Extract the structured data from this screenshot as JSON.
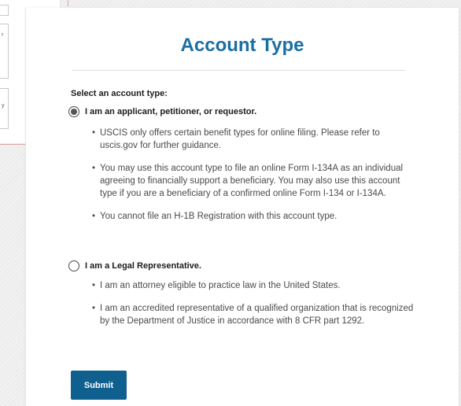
{
  "background": {
    "fragments": [
      "r",
      "y"
    ]
  },
  "page": {
    "title": "Account Type",
    "select_label": "Select an account type:"
  },
  "options": [
    {
      "label": "I am an applicant, petitioner, or requestor.",
      "selected": true,
      "bullets": [
        "USCIS only offers certain benefit types for online filing. Please refer to uscis.gov for further guidance.",
        "You may use this account type to file an online Form I-134A as an individual agreeing to financially support a beneficiary. You may also use this account type if you are a beneficiary of a confirmed online Form I-134 or I-134A.",
        "You cannot file an H-1B Registration with this account type."
      ]
    },
    {
      "label": "I am a Legal Representative.",
      "selected": false,
      "bullets": [
        "I am an attorney eligible to practice law in the United States.",
        "I am an accredited representative of a qualified organization that is recognized by the Department of Justice in accordance with 8 CFR part 1292."
      ]
    }
  ],
  "submit_label": "Submit",
  "colors": {
    "title": "#1a6fa3",
    "button": "#10608f"
  }
}
